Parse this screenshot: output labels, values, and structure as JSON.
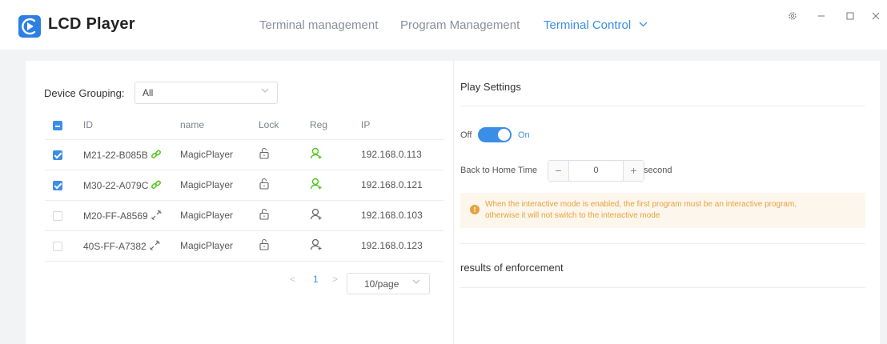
{
  "app": {
    "title": "LCD Player"
  },
  "nav": {
    "items": [
      {
        "label": "Terminal management",
        "active": false
      },
      {
        "label": "Program Management",
        "active": false
      },
      {
        "label": "Terminal Control",
        "active": true
      }
    ]
  },
  "window_controls": [
    "settings-icon",
    "minimize-icon",
    "maximize-icon",
    "close-icon"
  ],
  "colors": {
    "accent": "#3a8ee6",
    "connected": "#52c41a",
    "warning": "#e6a23c"
  },
  "left_panel": {
    "group_label": "Device Grouping:",
    "group_value": "All",
    "table": {
      "headers": [
        "ID",
        "name",
        "Lock",
        "Reg",
        "IP"
      ],
      "header_checkbox": "indeterminate",
      "rows": [
        {
          "checked": true,
          "id": "M21-22-B085B",
          "connected": true,
          "name": "MagicPlayer",
          "lock": "unlocked",
          "registered": true,
          "ip": "192.168.0.113"
        },
        {
          "checked": true,
          "id": "M30-22-A079C",
          "connected": true,
          "name": "MagicPlayer",
          "lock": "unlocked",
          "registered": true,
          "ip": "192.168.0.121"
        },
        {
          "checked": false,
          "id": "M20-FF-A8569",
          "connected": false,
          "name": "MagicPlayer",
          "lock": "unlocked",
          "registered": false,
          "ip": "192.168.0.103"
        },
        {
          "checked": false,
          "id": "40S-FF-A7382",
          "connected": false,
          "name": "MagicPlayer",
          "lock": "unlocked",
          "registered": false,
          "ip": "192.168.0.123"
        }
      ]
    },
    "pagination": {
      "prev": "<",
      "current": "1",
      "next": ">",
      "page_size": "10/page"
    }
  },
  "right_panel": {
    "play_settings_title": "Play Settings",
    "toggle": {
      "off_label": "Off",
      "on_label": "On",
      "state": "on"
    },
    "home_time": {
      "label": "Back to Home Time",
      "minus": "−",
      "value": "0",
      "plus": "+",
      "unit": "second"
    },
    "warning": {
      "line1": "When the interactive mode is enabled, the first program must be an interactive program,",
      "line2": "otherwise it will not switch to the interactive mode"
    },
    "results_title": "results of enforcement"
  }
}
